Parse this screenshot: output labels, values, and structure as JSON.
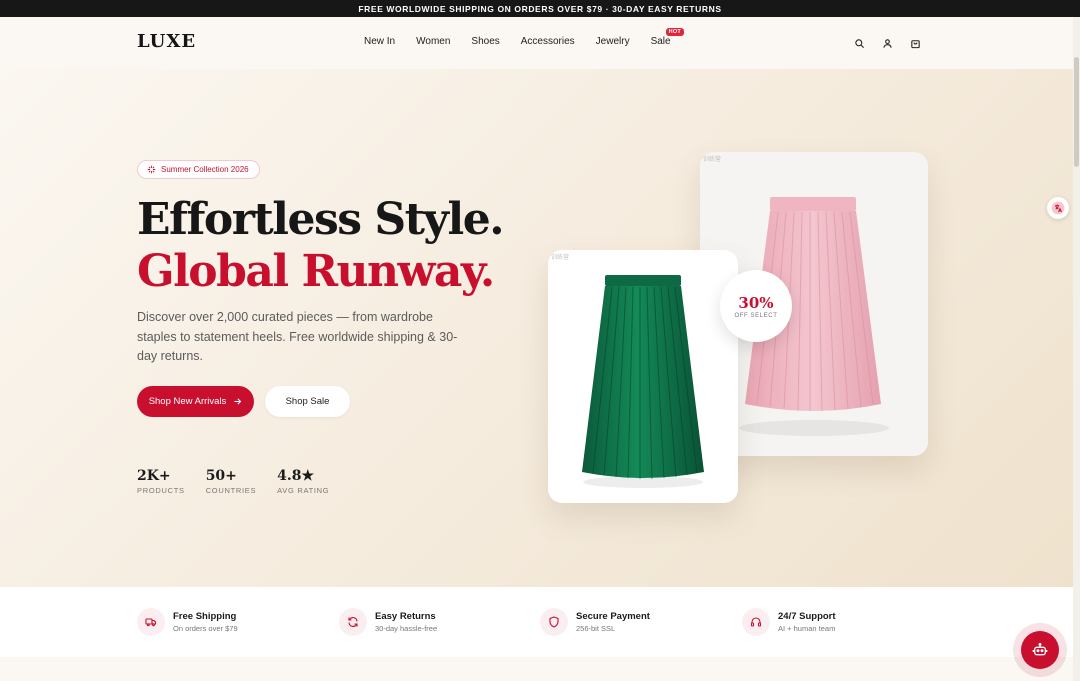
{
  "announcement": "FREE WORLDWIDE SHIPPING ON ORDERS OVER $79 · 30-DAY EASY RETURNS",
  "header": {
    "logo": "LUXE",
    "nav": [
      {
        "label": "New In"
      },
      {
        "label": "Women"
      },
      {
        "label": "Shoes"
      },
      {
        "label": "Accessories"
      },
      {
        "label": "Jewelry"
      },
      {
        "label": "Sale",
        "badge": "HOT"
      }
    ],
    "icons": [
      "search-icon",
      "user-icon",
      "shopping-bag-icon"
    ]
  },
  "hero": {
    "pill": "Summer Collection 2026",
    "headline_line1": "Effortless Style.",
    "headline_line2": "Global Runway.",
    "subtext": "Discover over 2,000 curated pieces — from wardrobe staples to statement heels. Free worldwide shipping & 30-day returns.",
    "primary_cta": "Shop New Arrivals",
    "secondary_cta": "Shop Sale",
    "stats": [
      {
        "value": "2K+",
        "label": "PRODUCTS"
      },
      {
        "value": "50+",
        "label": "COUNTRIES"
      },
      {
        "value": "4.8★",
        "label": "AVG RATING"
      }
    ],
    "card_tag": "训练营",
    "discount_value": "30%",
    "discount_label": "OFF SELECT"
  },
  "features": [
    {
      "title": "Free Shipping",
      "subtitle": "On orders over $79",
      "icon": "truck-icon"
    },
    {
      "title": "Easy Returns",
      "subtitle": "30-day hassle-free",
      "icon": "refresh-icon"
    },
    {
      "title": "Secure Payment",
      "subtitle": "256-bit SSL",
      "icon": "shield-icon"
    },
    {
      "title": "24/7 Support",
      "subtitle": "AI + human team",
      "icon": "headset-icon"
    }
  ],
  "colors": {
    "brand": "#c8102e",
    "dark": "#171717",
    "green_skirt": "#0f6b46",
    "pink_skirt": "#eeb4c0"
  }
}
